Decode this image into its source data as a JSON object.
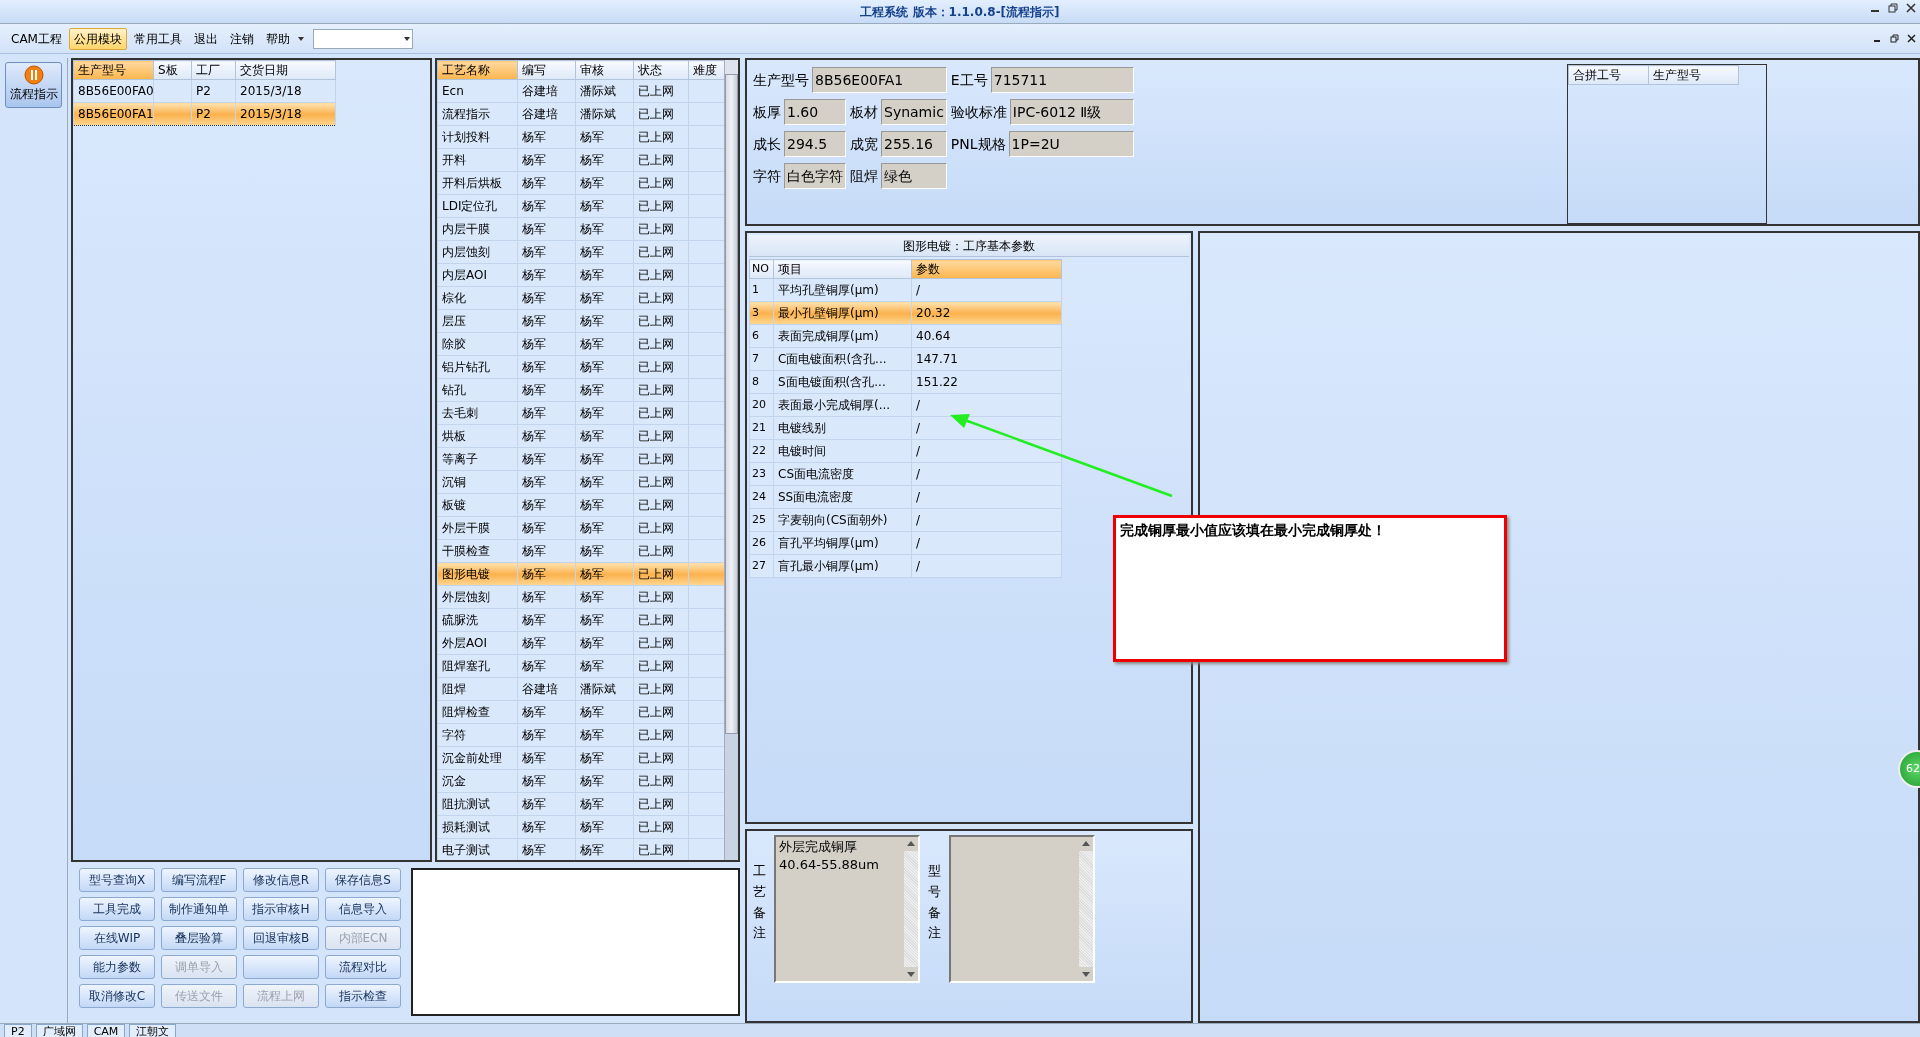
{
  "window": {
    "title": "工程系统 版本：1.1.0.8-[流程指示]"
  },
  "menu": [
    {
      "label": "CAM工程",
      "selected": false
    },
    {
      "label": "公用模块",
      "selected": true
    },
    {
      "label": "常用工具",
      "selected": false
    },
    {
      "label": "退出",
      "selected": false
    },
    {
      "label": "注销",
      "selected": false
    },
    {
      "label": "帮助",
      "selected": false
    }
  ],
  "nav": [
    {
      "label": "流程指示",
      "selected": true
    }
  ],
  "orders": {
    "columns": [
      {
        "label": "生产型号",
        "highlighted": true
      },
      {
        "label": "S板",
        "highlighted": false
      },
      {
        "label": "工厂",
        "highlighted": false
      },
      {
        "label": "交货日期",
        "highlighted": false
      }
    ],
    "rows": [
      {
        "part": "8B56E00FA0",
        "factory": "P2",
        "date": "2015/3/18",
        "selected": false
      },
      {
        "part": "8B56E00FA1",
        "factory": "P2",
        "date": "2015/3/18",
        "selected": true
      }
    ]
  },
  "processes": {
    "columns": [
      {
        "label": "工艺名称",
        "highlighted": true
      },
      {
        "label": "编写",
        "highlighted": false
      },
      {
        "label": "审核",
        "highlighted": false
      },
      {
        "label": "状态",
        "highlighted": false
      },
      {
        "label": "难度",
        "highlighted": false
      }
    ],
    "rows": [
      {
        "name": "Ecn",
        "writer": "谷建培",
        "reviewer": "潘际斌",
        "status": "已上网",
        "selected": false
      },
      {
        "name": "流程指示",
        "writer": "谷建培",
        "reviewer": "潘际斌",
        "status": "已上网",
        "selected": false
      },
      {
        "name": "计划投料",
        "writer": "杨军",
        "reviewer": "杨军",
        "status": "已上网",
        "selected": false
      },
      {
        "name": "开料",
        "writer": "杨军",
        "reviewer": "杨军",
        "status": "已上网",
        "selected": false
      },
      {
        "name": "开料后烘板",
        "writer": "杨军",
        "reviewer": "杨军",
        "status": "已上网",
        "selected": false
      },
      {
        "name": "LDI定位孔",
        "writer": "杨军",
        "reviewer": "杨军",
        "status": "已上网",
        "selected": false
      },
      {
        "name": "内层干膜",
        "writer": "杨军",
        "reviewer": "杨军",
        "status": "已上网",
        "selected": false
      },
      {
        "name": "内层蚀刻",
        "writer": "杨军",
        "reviewer": "杨军",
        "status": "已上网",
        "selected": false
      },
      {
        "name": "内层AOI",
        "writer": "杨军",
        "reviewer": "杨军",
        "status": "已上网",
        "selected": false
      },
      {
        "name": "棕化",
        "writer": "杨军",
        "reviewer": "杨军",
        "status": "已上网",
        "selected": false
      },
      {
        "name": "层压",
        "writer": "杨军",
        "reviewer": "杨军",
        "status": "已上网",
        "selected": false
      },
      {
        "name": "除胶",
        "writer": "杨军",
        "reviewer": "杨军",
        "status": "已上网",
        "selected": false
      },
      {
        "name": "铝片钻孔",
        "writer": "杨军",
        "reviewer": "杨军",
        "status": "已上网",
        "selected": false
      },
      {
        "name": "钻孔",
        "writer": "杨军",
        "reviewer": "杨军",
        "status": "已上网",
        "selected": false
      },
      {
        "name": "去毛刺",
        "writer": "杨军",
        "reviewer": "杨军",
        "status": "已上网",
        "selected": false
      },
      {
        "name": "烘板",
        "writer": "杨军",
        "reviewer": "杨军",
        "status": "已上网",
        "selected": false
      },
      {
        "name": "等离子",
        "writer": "杨军",
        "reviewer": "杨军",
        "status": "已上网",
        "selected": false
      },
      {
        "name": "沉铜",
        "writer": "杨军",
        "reviewer": "杨军",
        "status": "已上网",
        "selected": false
      },
      {
        "name": "板镀",
        "writer": "杨军",
        "reviewer": "杨军",
        "status": "已上网",
        "selected": false
      },
      {
        "name": "外层干膜",
        "writer": "杨军",
        "reviewer": "杨军",
        "status": "已上网",
        "selected": false
      },
      {
        "name": "干膜检查",
        "writer": "杨军",
        "reviewer": "杨军",
        "status": "已上网",
        "selected": false
      },
      {
        "name": "图形电镀",
        "writer": "杨军",
        "reviewer": "杨军",
        "status": "已上网",
        "selected": true
      },
      {
        "name": "外层蚀刻",
        "writer": "杨军",
        "reviewer": "杨军",
        "status": "已上网",
        "selected": false
      },
      {
        "name": "硫脲洗",
        "writer": "杨军",
        "reviewer": "杨军",
        "status": "已上网",
        "selected": false
      },
      {
        "name": "外层AOI",
        "writer": "杨军",
        "reviewer": "杨军",
        "status": "已上网",
        "selected": false
      },
      {
        "name": "阻焊塞孔",
        "writer": "杨军",
        "reviewer": "杨军",
        "status": "已上网",
        "selected": false
      },
      {
        "name": "阻焊",
        "writer": "谷建培",
        "reviewer": "潘际斌",
        "status": "已上网",
        "selected": false
      },
      {
        "name": "阻焊检查",
        "writer": "杨军",
        "reviewer": "杨军",
        "status": "已上网",
        "selected": false
      },
      {
        "name": "字符",
        "writer": "杨军",
        "reviewer": "杨军",
        "status": "已上网",
        "selected": false
      },
      {
        "name": "沉金前处理",
        "writer": "杨军",
        "reviewer": "杨军",
        "status": "已上网",
        "selected": false
      },
      {
        "name": "沉金",
        "writer": "杨军",
        "reviewer": "杨军",
        "status": "已上网",
        "selected": false
      },
      {
        "name": "阻抗测试",
        "writer": "杨军",
        "reviewer": "杨军",
        "status": "已上网",
        "selected": false
      },
      {
        "name": "损耗测试",
        "writer": "杨军",
        "reviewer": "杨军",
        "status": "已上网",
        "selected": false
      },
      {
        "name": "电子测试",
        "writer": "杨军",
        "reviewer": "杨军",
        "status": "已上网",
        "selected": false
      }
    ]
  },
  "buttons": [
    {
      "label": "型号查询X",
      "disabled": false
    },
    {
      "label": "编写流程F",
      "disabled": false
    },
    {
      "label": "修改信息R",
      "disabled": false
    },
    {
      "label": "保存信息S",
      "disabled": false
    },
    {
      "label": "工具完成",
      "disabled": false
    },
    {
      "label": "制作通知单",
      "disabled": false
    },
    {
      "label": "指示审核H",
      "disabled": false
    },
    {
      "label": "信息导入",
      "disabled": false
    },
    {
      "label": "在线WIP",
      "disabled": false
    },
    {
      "label": "叠层验算",
      "disabled": false
    },
    {
      "label": "回退审核B",
      "disabled": false
    },
    {
      "label": "内部ECN",
      "disabled": true
    },
    {
      "label": "能力参数",
      "disabled": false
    },
    {
      "label": "调单导入",
      "disabled": true
    },
    {
      "disabled": false
    },
    {
      "label": "流程对比",
      "disabled": false
    },
    {
      "label": "取消修改C",
      "disabled": false
    },
    {
      "label": "传送文件",
      "disabled": true
    },
    {
      "label": "流程上网",
      "disabled": true
    },
    {
      "label": "指示检查",
      "disabled": false
    }
  ],
  "info": {
    "fields": [
      {
        "label": "生产型号",
        "value": "8B56E00FA1"
      },
      {
        "label": "E工号",
        "value": "715711"
      },
      {
        "label": "板厚",
        "value": "1.60"
      },
      {
        "label": "板材",
        "value": "Synamic"
      },
      {
        "label": "验收标准",
        "value": "IPC-6012 Ⅱ级"
      },
      {
        "label": "成长",
        "value": "294.5"
      },
      {
        "label": "成宽",
        "value": "255.16"
      },
      {
        "label": "PNL规格",
        "value": "1P=2U"
      },
      {
        "label": "字符",
        "value": "白色字符"
      },
      {
        "label": "阻焊",
        "value": "绿色"
      }
    ],
    "merge_table": {
      "columns": [
        "合拼工号",
        "生产型号"
      ]
    }
  },
  "params": {
    "title": "图形电镀：工序基本参数",
    "columns": [
      {
        "label": "NO",
        "highlighted": false
      },
      {
        "label": "项目",
        "highlighted": false
      },
      {
        "label": "参数",
        "highlighted": true
      }
    ],
    "rows": [
      {
        "no": "1",
        "item": "平均孔壁铜厚(μm)",
        "value": "/",
        "selected": false
      },
      {
        "no": "3",
        "item": "最小孔壁铜厚(μm)",
        "value": "20.32",
        "selected": true
      },
      {
        "no": "6",
        "item": "表面完成铜厚(μm)",
        "value": "40.64",
        "selected": false
      },
      {
        "no": "7",
        "item": "C面电镀面积(含孔...",
        "value": "147.71",
        "selected": false
      },
      {
        "no": "8",
        "item": "S面电镀面积(含孔...",
        "value": "151.22",
        "selected": false
      },
      {
        "no": "20",
        "item": "表面最小完成铜厚(...",
        "value": "/",
        "selected": false
      },
      {
        "no": "21",
        "item": "电镀线别",
        "value": "/",
        "selected": false
      },
      {
        "no": "22",
        "item": "电镀时间",
        "value": "/",
        "selected": false
      },
      {
        "no": "23",
        "item": "CS面电流密度",
        "value": "/",
        "selected": false
      },
      {
        "no": "24",
        "item": "SS面电流密度",
        "value": "/",
        "selected": false
      },
      {
        "no": "25",
        "item": "字麦朝向(CS面朝外)",
        "value": "/",
        "selected": false
      },
      {
        "no": "26",
        "item": "盲孔平均铜厚(μm)",
        "value": "/",
        "selected": false
      },
      {
        "no": "27",
        "item": "盲孔最小铜厚(μm)",
        "value": "/",
        "selected": false
      }
    ]
  },
  "annotation": {
    "text": "完成铜厚最小值应该填在最小完成铜厚处！"
  },
  "remarks": [
    {
      "label": "工艺备注",
      "value": "外层完成铜厚\n40.64-55.88um"
    },
    {
      "label": "型号备注"
    }
  ],
  "side_badge": "62",
  "status_tabs": [
    "P2",
    "广域网",
    "CAM",
    "江朝文"
  ]
}
